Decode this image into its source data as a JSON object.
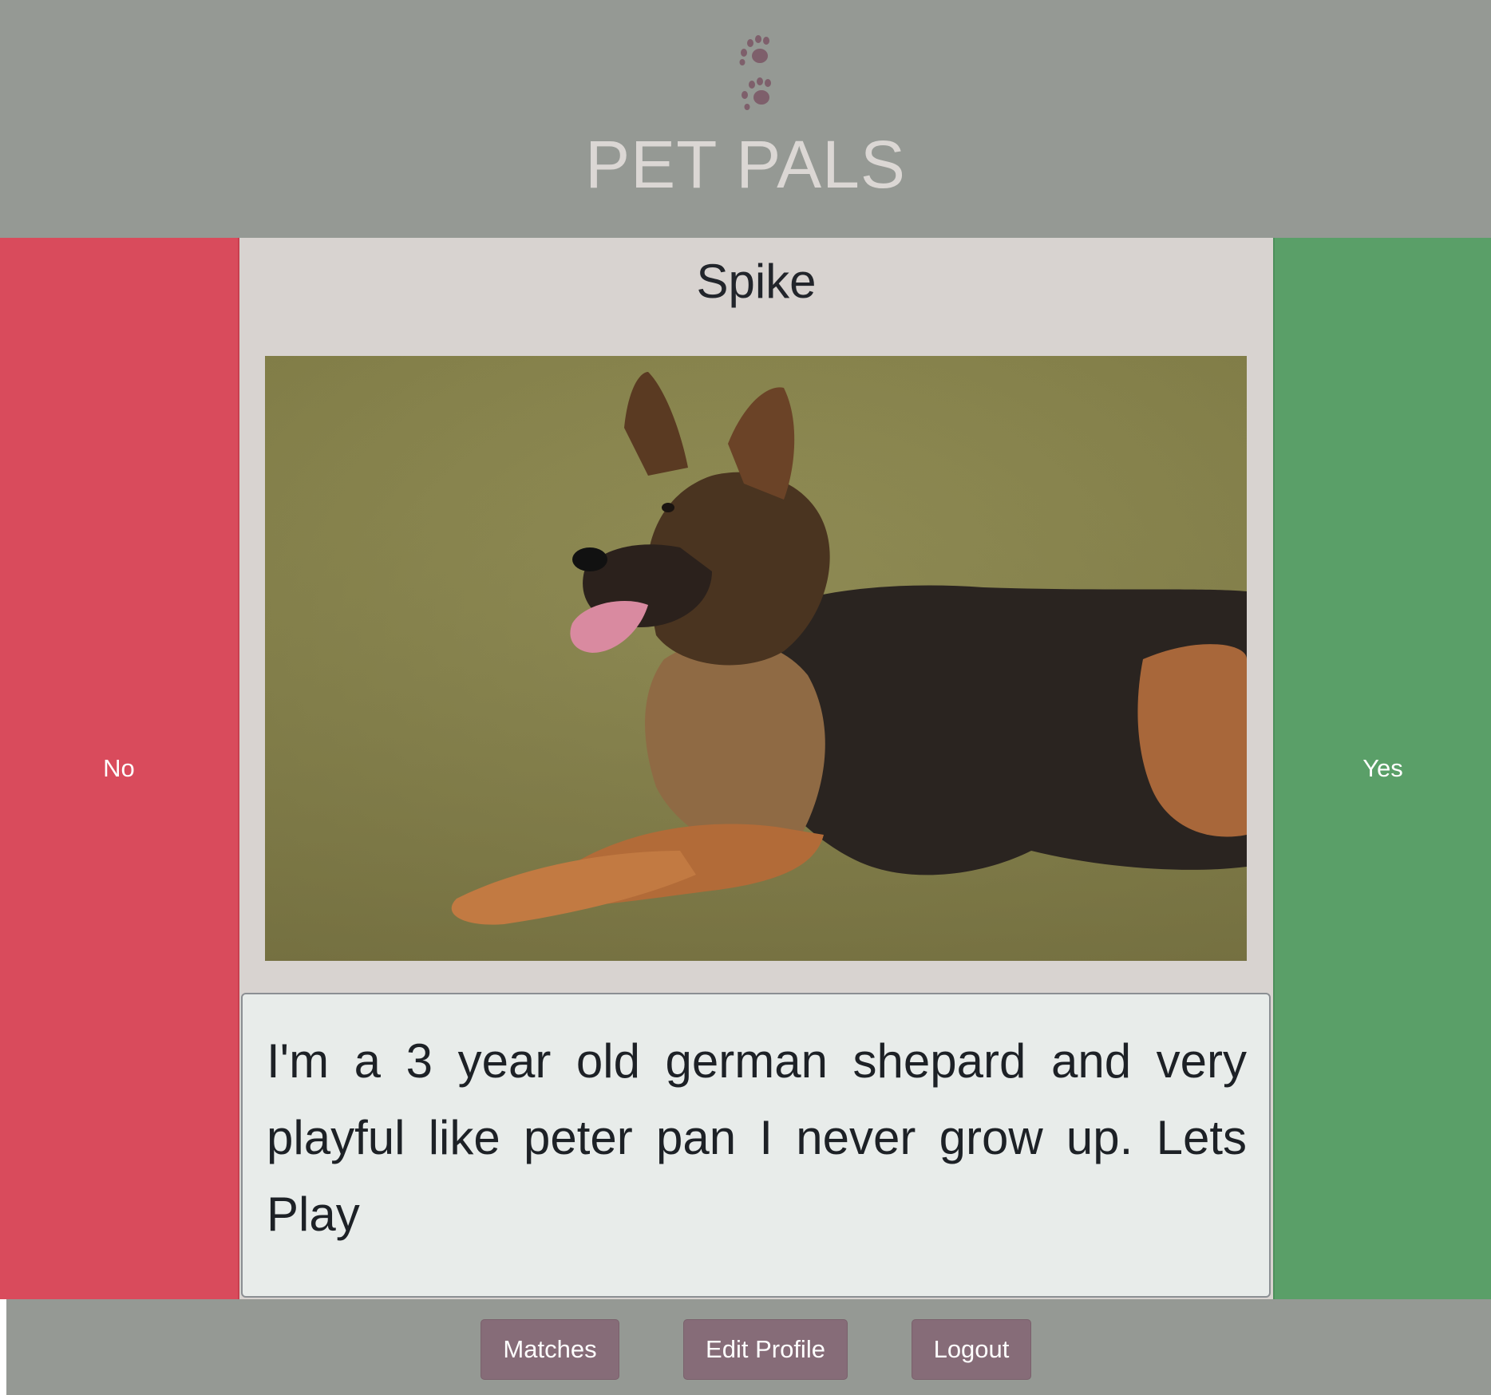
{
  "header": {
    "logo_icon": "paw-prints-icon",
    "brand": "PET PALS"
  },
  "swipe": {
    "no_label": "No",
    "yes_label": "Yes"
  },
  "profile": {
    "name": "Spike",
    "photo_icon": "dog-photo",
    "bio": "I'm a 3 year old german shepard and very playful like peter pan I never grow up. Lets Play"
  },
  "footer": {
    "matches_label": "Matches",
    "edit_profile_label": "Edit Profile",
    "logout_label": "Logout"
  },
  "colors": {
    "header_bg": "#959994",
    "brand_text": "#dbd7d4",
    "no_bg": "#d94b5c",
    "yes_bg": "#5a9f68",
    "card_bg": "#d8d3d0",
    "bio_bg": "#e8ecea",
    "nav_button_bg": "#866c78",
    "paw_color": "#7e5f6b"
  }
}
